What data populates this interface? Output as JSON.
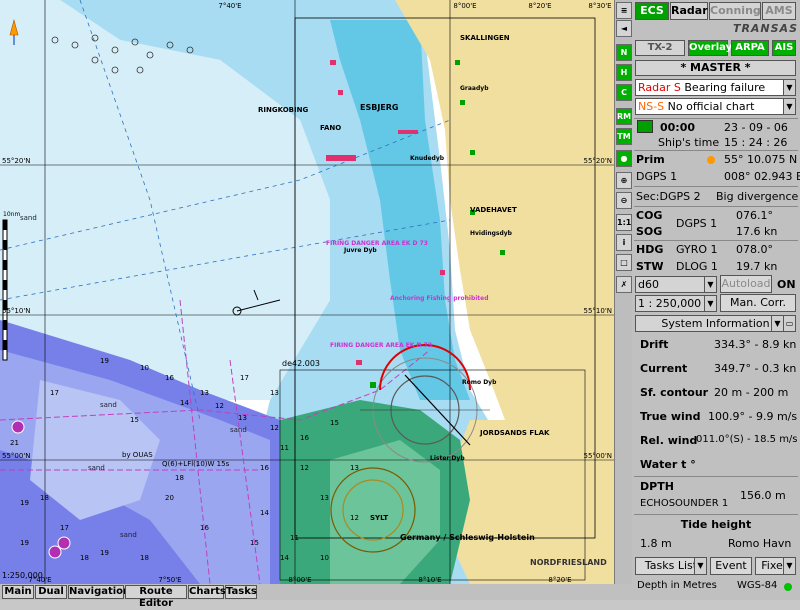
{
  "chart": {
    "lat_labels": [
      "55°20'N",
      "55°10'N",
      "55°00'N"
    ],
    "lon_labels": [
      "7°40'E",
      "8°00'E",
      "8°20'E",
      "8°30'E"
    ],
    "right_lat_labels": [
      "55°20'N",
      "55°10'N",
      "55°00'N"
    ],
    "bottom_lon_labels": [
      "7°40'E",
      "7°50'E",
      "8°00'E",
      "8°10'E",
      "8°20'E"
    ],
    "place_names": [
      "ESBJERG",
      "SKALLINGEN",
      "FANO",
      "RINGKOBING",
      "VADEHAVET",
      "JORDSANDS FLAK",
      "NORDFRIESLAND",
      "Germany / Schleswig-Holstein",
      "SYLT",
      "Romo Dyb",
      "Hvidingsdyb",
      "Graadyb",
      "Knudedyb",
      "Juvre Dyb",
      "Lister Dyb"
    ],
    "danger_labels": [
      "FIRING DANGER AREA EK D 73",
      "FIRING DANGER AREA EK D 73",
      "Anchoring Fishing prohibited"
    ],
    "sand_labels": [
      "sand",
      "sand",
      "sand",
      "sand",
      "sand"
    ],
    "depths_left": [
      "19",
      "10",
      "16",
      "15",
      "13",
      "18",
      "20",
      "21",
      "17",
      "14",
      "12",
      "13",
      "19",
      "18",
      "17",
      "16",
      "18",
      "19",
      "18",
      "19"
    ],
    "depths_sea": [
      "11",
      "12",
      "13",
      "14",
      "15",
      "16",
      "17",
      "13",
      "12",
      "11",
      "10",
      "14",
      "15",
      "16",
      "13",
      "12"
    ],
    "scale_label": "1:250,000",
    "scale_bar_label": "10nm",
    "cursor_label": "de42.003",
    "light_label": "Q(6)+LFl(10)W 15s",
    "buoy_label": "by OUAS"
  },
  "toolbar_right": [
    "≡",
    "◄",
    "N UP",
    "H UP",
    "C UP",
    "RM",
    "TM",
    "●",
    "⊕",
    "⊖",
    "1:1",
    "i",
    "□",
    "✗"
  ],
  "panel": {
    "mode_buttons": [
      "ECS",
      "Radar",
      "Conning",
      "AMS"
    ],
    "brand": "TRANSAS",
    "sub_buttons": [
      "TX-2",
      "Overlay",
      "ARPA",
      "AIS"
    ],
    "master_label": "* MASTER *",
    "alarm1_prefix": "Radar S",
    "alarm1_text": "Bearing failure",
    "alarm2_prefix": "NS-S",
    "alarm2_text": "No official chart",
    "time_hhmm": "00:00",
    "date": "23 - 09 - 06",
    "ships_time_label": "Ship's time",
    "ships_time": "15 : 24 : 26",
    "prim_label": "Prim",
    "prim_lat": "55° 10.075 N",
    "dgps1_label": "DGPS 1",
    "dgps1_lon": "008° 02.943 E",
    "sec_label": "Sec:DGPS 2",
    "sec_value": "Big divergence",
    "cog_label": "COG",
    "sog_label": "SOG",
    "dgps_src_label": "DGPS 1",
    "cog_value": "076.1°",
    "sog_value": "17.6 kn",
    "hdg_label": "HDG",
    "gyro_label": "GYRO 1",
    "hdg_value": "078.0°",
    "stw_label": "STW",
    "dlog_label": "DLOG 1",
    "stw_value": "19.7 kn",
    "chart_select": "d60",
    "autoload_label": "Autoload",
    "autoload_state": "ON",
    "scale_select": "1 : 250,000",
    "man_corr_label": "Man. Corr.",
    "sysinfo_label": "System Information",
    "drift_label": "Drift",
    "drift_value": "334.3° - 8.9 kn",
    "current_label": "Current",
    "current_value": "349.7° - 0.3 kn",
    "sf_label": "Sf. contour",
    "sf_value": "20 m - 200 m",
    "truewind_label": "True wind",
    "truewind_value": "100.9° - 9.9 m/s",
    "relwind_label": "Rel. wind",
    "relwind_value": "011.0°(S) - 18.5 m/s",
    "water_label": "Water t °",
    "dpth_label": "DPTH",
    "echo_label": "ECHOSOUNDER 1",
    "dpth_value": "156.0 m",
    "tide_label": "Tide height",
    "tide_value": "1.8 m",
    "tide_station": "Romo Havn",
    "tasks_label": "Tasks List",
    "event_label": "Event",
    "fixed_label": "Fixed",
    "depth_units": "Depth in Metres",
    "datum": "WGS-84"
  },
  "bottom_tabs": [
    "Main",
    "Dual",
    "Navigation",
    "Route Editor",
    "Charts",
    "Tasks"
  ],
  "colors": {
    "deep_sea": "#ffffff",
    "shallow_blue": "#9fd8f0",
    "shoal_blue": "#63c7e6",
    "drying_green": "#3aa87a",
    "land": "#f1dfa0",
    "restricted_area": "#6b74e6",
    "ecs_green": "#00a000",
    "alarm_red": "#e00000",
    "alarm_orange": "#ff6600"
  }
}
